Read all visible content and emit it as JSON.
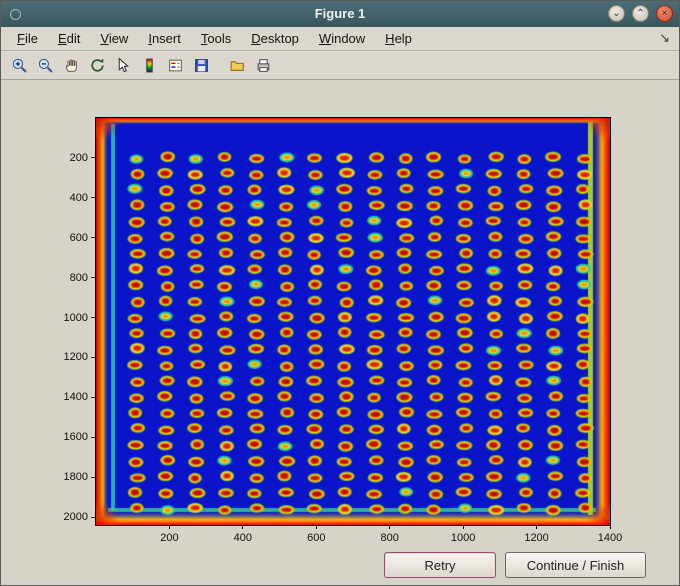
{
  "titlebar": {
    "title": "Figure 1",
    "minimize_glyph": "⌄",
    "maximize_glyph": "⌃",
    "close_glyph": "×"
  },
  "menubar": {
    "items": [
      "File",
      "Edit",
      "View",
      "Insert",
      "Tools",
      "Desktop",
      "Window",
      "Help"
    ],
    "dock_glyph": "↘"
  },
  "toolbar": {
    "icons": [
      "zoom-in-icon",
      "zoom-out-icon",
      "pan-icon",
      "rotate-3d-icon",
      "data-cursor-icon",
      "colorbar-icon",
      "legend-icon",
      "save-icon",
      "open-icon",
      "print-icon"
    ]
  },
  "plot": {
    "x_ticks": [
      200,
      400,
      600,
      800,
      1000,
      1200,
      1400
    ],
    "y_ticks": [
      200,
      400,
      600,
      800,
      1000,
      1200,
      1400,
      1600,
      1800,
      2000
    ],
    "x_max": 1400,
    "y_max": 2040,
    "grid": {
      "cols": 16,
      "rows": 23,
      "x_start": 110,
      "x_end": 1330,
      "y_start": 200,
      "y_end": 1960
    },
    "colors": {
      "background": "#0a14c8",
      "edge_hot": "#b40a00",
      "edge_warm": "#ff7800",
      "edge_yellow": "#ffd400",
      "stripe_cyan": "#28c8be",
      "stripe_green": "#3cd28c",
      "stripe_lime": "#b4dc28"
    }
  },
  "buttons": {
    "retry": "Retry",
    "continue_finish": "Continue / Finish"
  }
}
